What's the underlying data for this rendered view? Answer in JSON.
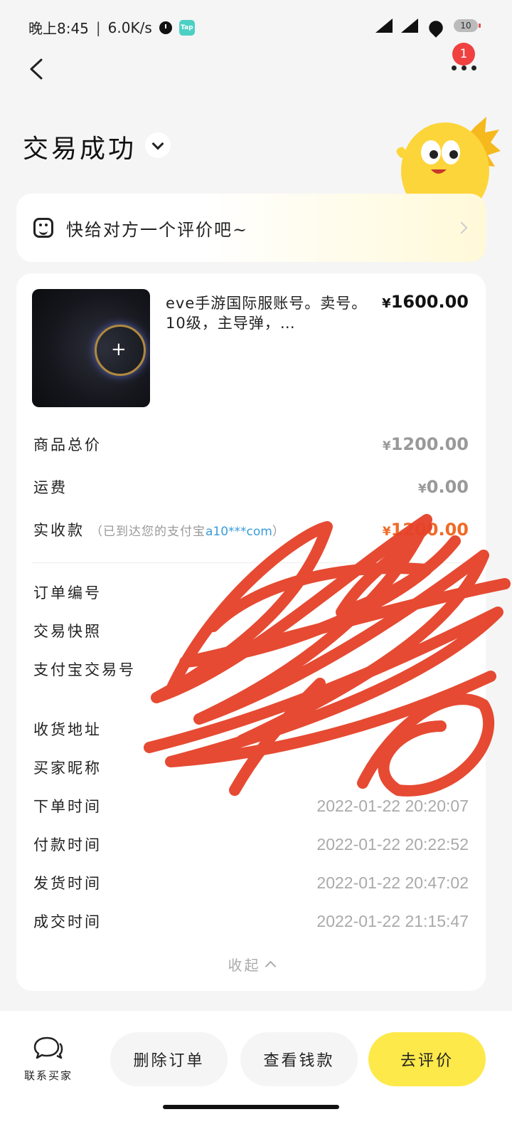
{
  "status_bar": {
    "time": "晚上8:45",
    "separator": "|",
    "speed": "6.0K/s",
    "tap_label": "Tap",
    "battery": "10"
  },
  "header": {
    "notification_count": "1",
    "title": "交易成功"
  },
  "review_prompt": {
    "text": "快给对方一个评价吧~"
  },
  "product": {
    "title": "eve手游国际服账号。卖号。10级，主导弹，…",
    "price_symbol": "¥",
    "price": "1600.00"
  },
  "price_rows": [
    {
      "label": "商品总价",
      "symbol": "¥",
      "value": "1200.00"
    },
    {
      "label": "运费",
      "symbol": "¥",
      "value": "0.00"
    },
    {
      "label": "实收款",
      "note_prefix": "（已到达您的支付宝",
      "note_account": "a10***com",
      "note_suffix": "）",
      "symbol": "¥",
      "value": "1200.00"
    }
  ],
  "info_rows": [
    {
      "label": "订单编号",
      "value": ""
    },
    {
      "label": "交易快照",
      "value": ""
    },
    {
      "label": "支付宝交易号",
      "value": ""
    },
    {
      "label": "收货地址",
      "value": ""
    },
    {
      "label": "买家昵称",
      "value": ""
    },
    {
      "label": "下单时间",
      "value": "2022-01-22  20:20:07"
    },
    {
      "label": "付款时间",
      "value": "2022-01-22  20:22:52"
    },
    {
      "label": "发货时间",
      "value": "2022-01-22  20:47:02"
    },
    {
      "label": "成交时间",
      "value": "2022-01-22  21:15:47"
    }
  ],
  "collapse_label": "收起",
  "bottom_bar": {
    "contact_label": "联系买家",
    "delete_label": "删除订单",
    "view_payment_label": "查看钱款",
    "review_label": "去评价"
  },
  "colors": {
    "accent_yellow": "#fde94a",
    "price_orange": "#f06a25",
    "badge_red": "#f04040",
    "scribble_red": "#e5432a"
  }
}
